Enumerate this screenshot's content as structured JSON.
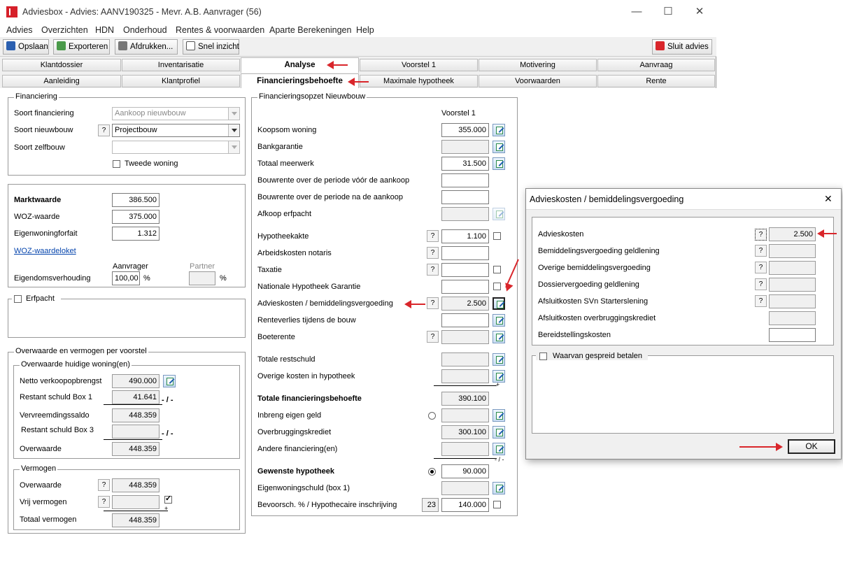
{
  "window": {
    "title": "Adviesbox - Advies: AANV190325 - Mevr. A.B. Aanvrager (56)",
    "controls": {
      "minimize": "—",
      "maximize": "☐",
      "close": "✕"
    }
  },
  "menu": [
    "Advies",
    "Overzichten",
    "HDN",
    "Onderhoud",
    "Rentes & voorwaarden",
    "Aparte Berekeningen",
    "Help"
  ],
  "toolbar": {
    "save": "Opslaan",
    "export": "Exporteren",
    "print": "Afdrukken...",
    "quick": "Snel inzicht",
    "close": "Sluit advies"
  },
  "tabs_row1": [
    "Klantdossier",
    "Inventarisatie",
    "Analyse",
    "Voorstel 1",
    "Motivering",
    "Aanvraag"
  ],
  "tabs_row2": [
    "Aanleiding",
    "Klantprofiel",
    "Financieringsbehoefte",
    "Maximale hypotheek",
    "Voorwaarden",
    "Rente"
  ],
  "financiering": {
    "title": "Financiering",
    "soort_financiering_label": "Soort financiering",
    "soort_financiering": "Aankoop nieuwbouw",
    "soort_nieuwbouw_label": "Soort nieuwbouw",
    "soort_nieuwbouw": "Projectbouw",
    "soort_zelfbouw_label": "Soort zelfbouw",
    "soort_zelfbouw": "",
    "tweede_woning": "Tweede woning"
  },
  "waarde": {
    "marktwaarde_label": "Marktwaarde",
    "marktwaarde": "386.500",
    "woz_label": "WOZ-waarde",
    "woz": "375.000",
    "ewf_label": "Eigenwoningforfait",
    "ewf": "1.312",
    "link": "WOZ-waardeloket",
    "aanvrager": "Aanvrager",
    "partner": "Partner",
    "eigendom_label": "Eigendomsverhouding",
    "eigendom_aanvrager": "100,00",
    "eigendom_partner": "",
    "pct": "%"
  },
  "erfpacht": {
    "label": "Erfpacht"
  },
  "overwaarde": {
    "title": "Overwaarde en vermogen per voorstel",
    "sub1": "Overwaarde huidige woning(en)",
    "netto_label": "Netto verkoopopbrengst",
    "netto": "490.000",
    "restant1_label": "Restant schuld Box 1",
    "restant1": "41.641",
    "vervreemding_label": "Vervreemdingssaldo",
    "vervreemding": "448.359",
    "restant3_label": "Restant schuld Box 3",
    "restant3": "",
    "overwaarde_label": "Overwaarde",
    "overwaarde": "448.359",
    "minus": "- / -",
    "sub2": "Vermogen",
    "v_overwaarde_label": "Overwaarde",
    "v_overwaarde": "448.359",
    "vrij_label": "Vrij vermogen",
    "vrij": "",
    "plus": "+",
    "totaal_label": "Totaal vermogen",
    "totaal": "448.359"
  },
  "opzet": {
    "title": "Financieringsopzet Nieuwbouw",
    "col": "Voorstel 1",
    "rows": [
      {
        "label": "Koopsom woning",
        "value": "355.000"
      },
      {
        "label": "Bankgarantie",
        "value": ""
      },
      {
        "label": "Totaal meerwerk",
        "value": "31.500"
      },
      {
        "label": "Bouwrente over de periode vóór de aankoop",
        "value": ""
      },
      {
        "label": "Bouwrente over de periode na de aankoop",
        "value": ""
      },
      {
        "label": "Afkoop erfpacht",
        "value": ""
      },
      {
        "label": "Hypotheekakte",
        "value": "1.100"
      },
      {
        "label": "Arbeidskosten notaris",
        "value": ""
      },
      {
        "label": "Taxatie",
        "value": ""
      },
      {
        "label": "Nationale Hypotheek Garantie",
        "value": ""
      },
      {
        "label": "Advieskosten / bemiddelingsvergoeding",
        "value": "2.500"
      },
      {
        "label": "Renteverlies tijdens de bouw",
        "value": ""
      },
      {
        "label": "Boeterente",
        "value": ""
      },
      {
        "label": "Totale restschuld",
        "value": ""
      },
      {
        "label": "Overige kosten in hypotheek",
        "value": ""
      },
      {
        "label": "Totale financieringsbehoefte",
        "value": "390.100"
      },
      {
        "label": "Inbreng eigen geld",
        "value": ""
      },
      {
        "label": "Overbruggingskrediet",
        "value": "300.100"
      },
      {
        "label": "Andere financiering(en)",
        "value": ""
      },
      {
        "label": "Gewenste hypotheek",
        "value": "90.000"
      },
      {
        "label": "Eigenwoningschuld (box 1)",
        "value": ""
      },
      {
        "label": "Bevoorsch. % / Hypothecaire inschrijving",
        "value": "140.000",
        "pct": "23"
      }
    ],
    "plus": "+",
    "minus": "- / -"
  },
  "dialog": {
    "title": "Advieskosten / bemiddelingsvergoeding",
    "close": "✕",
    "rows": [
      {
        "label": "Advieskosten",
        "value": "2.500"
      },
      {
        "label": "Bemiddelingsvergoeding geldlening",
        "value": ""
      },
      {
        "label": "Overige bemiddelingsvergoeding",
        "value": ""
      },
      {
        "label": "Dossiervergoeding geldlening",
        "value": ""
      },
      {
        "label": "Afsluitkosten SVn Starterslening",
        "value": ""
      },
      {
        "label": "Afsluitkosten overbruggingskrediet",
        "value": ""
      },
      {
        "label": "Bereidstellingskosten",
        "value": ""
      }
    ],
    "gespreid": "Waarvan gespreid betalen",
    "ok": "OK"
  },
  "icons": {
    "logo": "adviesbox-logo-icon",
    "save": "floppy-icon",
    "export": "export-icon",
    "print": "printer-icon",
    "quick": "document-icon",
    "close": "close-red-icon",
    "edit": "edit-icon",
    "help": "question-icon"
  },
  "colors": {
    "accent": "#d9262b",
    "link": "#0645ad"
  }
}
